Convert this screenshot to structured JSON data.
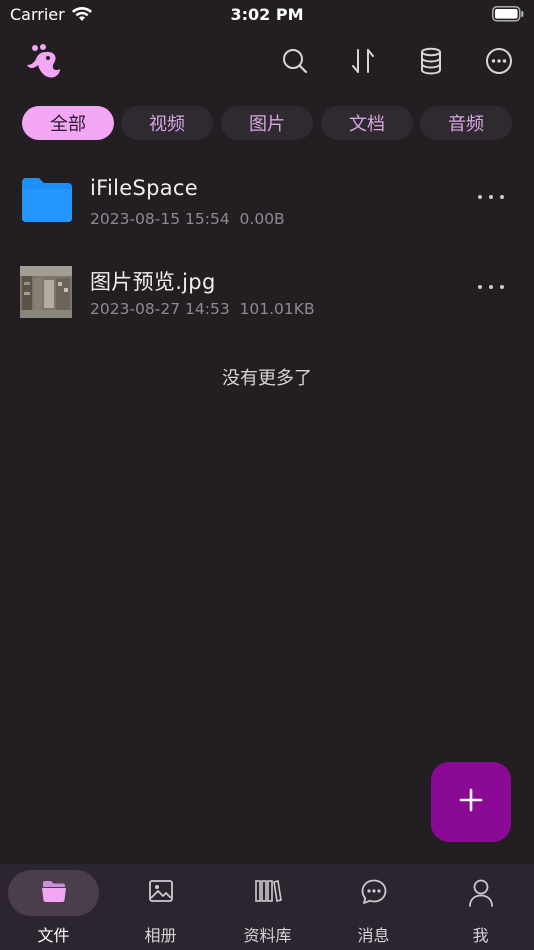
{
  "status_bar": {
    "carrier": "Carrier",
    "time": "3:02 PM"
  },
  "header": {
    "logo_icon": "seahorse-logo-icon",
    "actions": [
      "search-icon",
      "sort-icon",
      "storage-icon",
      "more-icon"
    ]
  },
  "filters": {
    "items": [
      {
        "label": "全部",
        "active": true
      },
      {
        "label": "视频",
        "active": false
      },
      {
        "label": "图片",
        "active": false
      },
      {
        "label": "文档",
        "active": false
      },
      {
        "label": "音频",
        "active": false
      }
    ]
  },
  "files": [
    {
      "name": "iFileSpace",
      "date": "2023-08-15 15:54",
      "size": "0.00B",
      "type": "folder",
      "icon": "folder-icon"
    },
    {
      "name": "图片预览.jpg",
      "date": "2023-08-27 14:53",
      "size": "101.01KB",
      "type": "image",
      "icon": "image-thumbnail"
    }
  ],
  "list_footer": "没有更多了",
  "fab": {
    "icon": "plus-icon"
  },
  "tabbar": {
    "items": [
      {
        "label": "文件",
        "icon": "folder-open-icon",
        "active": true
      },
      {
        "label": "相册",
        "icon": "photo-icon",
        "active": false
      },
      {
        "label": "资料库",
        "icon": "library-icon",
        "active": false
      },
      {
        "label": "消息",
        "icon": "chat-icon",
        "active": false
      },
      {
        "label": "我",
        "icon": "user-icon",
        "active": false
      }
    ]
  },
  "colors": {
    "background": "#221e22",
    "accent": "#f2a6f4",
    "fab": "#8a0a96",
    "folder": "#1e8ff5"
  }
}
